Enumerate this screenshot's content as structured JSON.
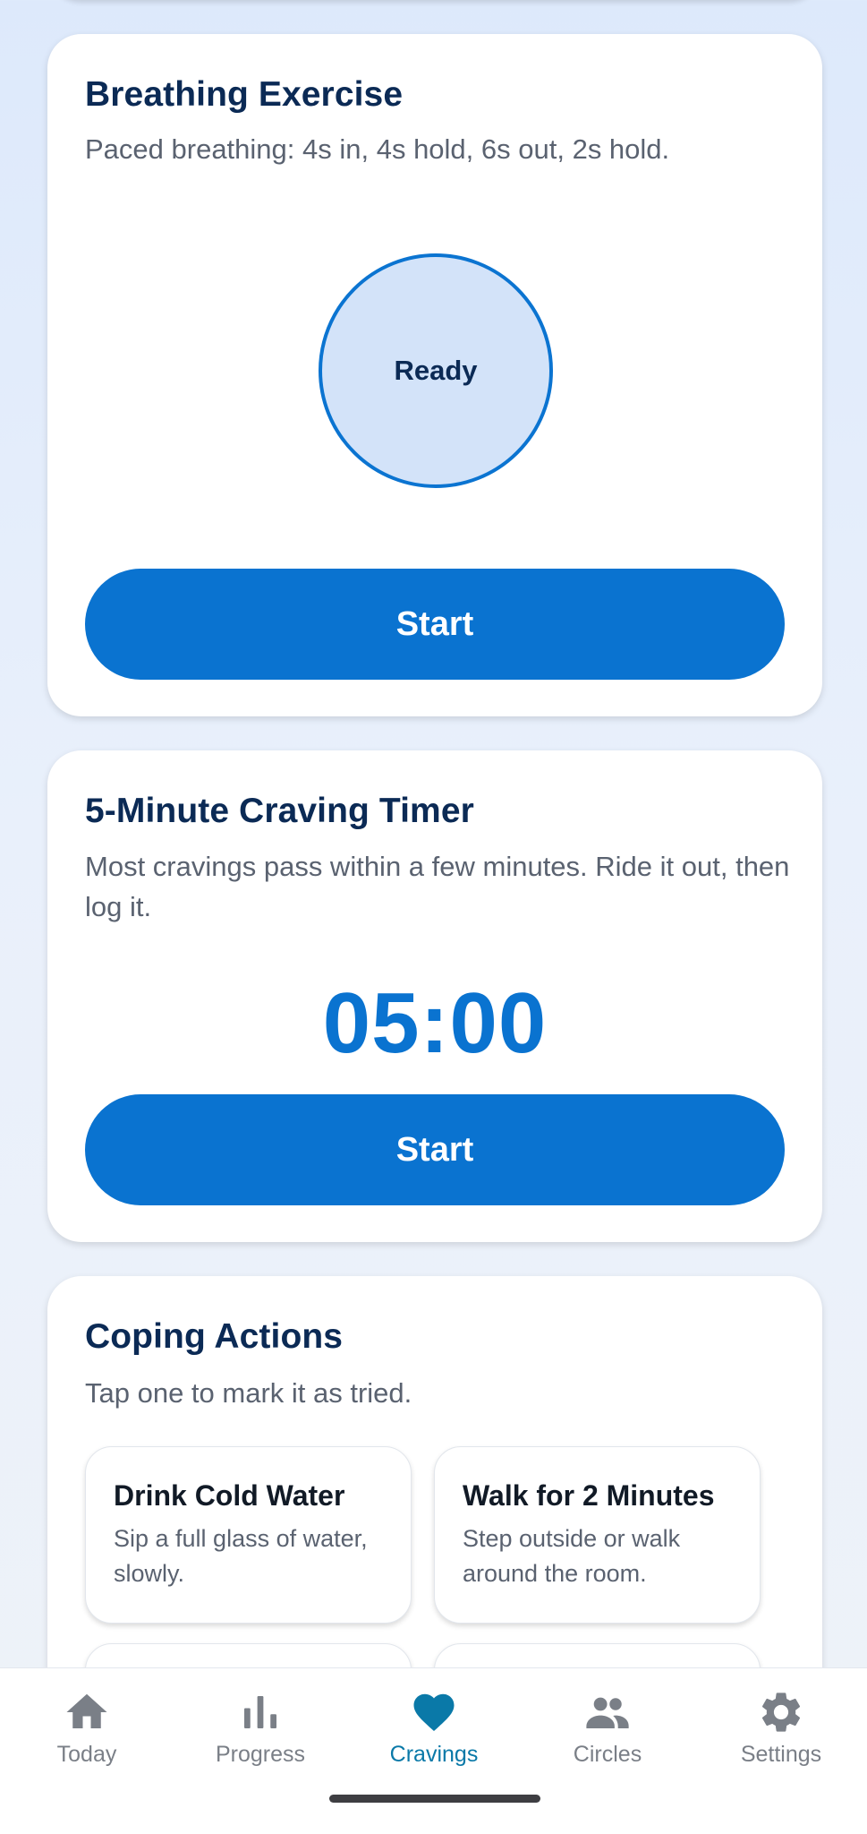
{
  "breathing": {
    "title": "Breathing Exercise",
    "description": "Paced breathing: 4s in, 4s hold, 6s out, 2s hold.",
    "state_label": "Ready",
    "start_label": "Start"
  },
  "timer": {
    "title": "5-Minute Craving Timer",
    "description": "Most cravings pass within a few minutes. Ride it out, then log it.",
    "display": "05:00",
    "start_label": "Start"
  },
  "coping": {
    "title": "Coping Actions",
    "subtitle": "Tap one to mark it as tried.",
    "actions": [
      {
        "title": "Drink Cold Water",
        "description": "Sip a full glass of water, slowly."
      },
      {
        "title": "Walk for 2 Minutes",
        "description": "Step outside or walk around the room."
      }
    ]
  },
  "nav": {
    "items": [
      {
        "label": "Today",
        "icon": "home-icon"
      },
      {
        "label": "Progress",
        "icon": "bar-chart-icon"
      },
      {
        "label": "Cravings",
        "icon": "heart-icon"
      },
      {
        "label": "Circles",
        "icon": "people-icon"
      },
      {
        "label": "Settings",
        "icon": "gear-icon"
      }
    ],
    "active": "Cravings"
  },
  "colors": {
    "primary": "#0a73d0",
    "title": "#0b2a55",
    "active_nav": "#0a79a8",
    "inactive_nav": "#7a7f87"
  }
}
